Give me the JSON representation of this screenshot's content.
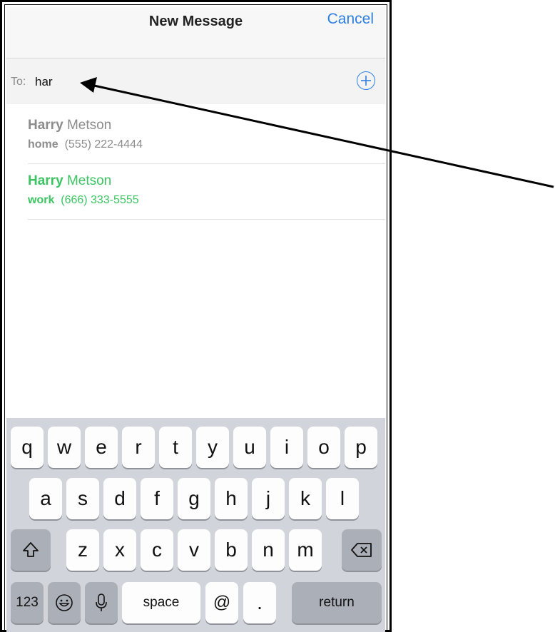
{
  "navbar": {
    "title": "New Message",
    "cancel": "Cancel"
  },
  "to_field": {
    "label": "To:",
    "value": "har",
    "add_icon": "plus-circle-icon"
  },
  "suggestions": [
    {
      "first": "Harry",
      "last": "Metson",
      "type": "home",
      "phone": "(555) 222-4444",
      "color": "#8c8c8c"
    },
    {
      "first": "Harry",
      "last": "Metson",
      "type": "work",
      "phone": "(666) 333-5555",
      "color": "#3cc463"
    }
  ],
  "keyboard": {
    "row1": [
      "q",
      "w",
      "e",
      "r",
      "t",
      "y",
      "u",
      "i",
      "o",
      "p"
    ],
    "row2": [
      "a",
      "s",
      "d",
      "f",
      "g",
      "h",
      "j",
      "k",
      "l"
    ],
    "row3": [
      "z",
      "x",
      "c",
      "v",
      "b",
      "n",
      "m"
    ],
    "shift_icon": "shift-icon",
    "backspace_icon": "backspace-icon",
    "numbers": "123",
    "emoji_icon": "emoji-icon",
    "mic_icon": "microphone-icon",
    "space": "space",
    "at": "@",
    "dot": ".",
    "return": "return"
  },
  "annotation": {
    "arrow_icon": "arrow-pointer-icon",
    "color": "#000000"
  }
}
